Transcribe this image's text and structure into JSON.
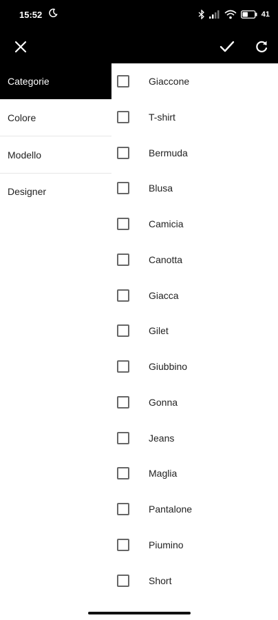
{
  "status_bar": {
    "time": "15:52",
    "battery": "41"
  },
  "toolbar": {
    "close_icon": "close-icon",
    "confirm_icon": "check-icon",
    "reset_icon": "refresh-icon"
  },
  "sidebar": {
    "items": [
      {
        "label": "Categorie",
        "active": true
      },
      {
        "label": "Colore",
        "active": false
      },
      {
        "label": "Modello",
        "active": false
      },
      {
        "label": "Designer",
        "active": false
      }
    ]
  },
  "options": [
    {
      "label": "Giaccone",
      "checked": false
    },
    {
      "label": "T-shirt",
      "checked": false
    },
    {
      "label": "Bermuda",
      "checked": false
    },
    {
      "label": "Blusa",
      "checked": false
    },
    {
      "label": "Camicia",
      "checked": false
    },
    {
      "label": "Canotta",
      "checked": false
    },
    {
      "label": "Giacca",
      "checked": false
    },
    {
      "label": "Gilet",
      "checked": false
    },
    {
      "label": "Giubbino",
      "checked": false
    },
    {
      "label": "Gonna",
      "checked": false
    },
    {
      "label": "Jeans",
      "checked": false
    },
    {
      "label": "Maglia",
      "checked": false
    },
    {
      "label": "Pantalone",
      "checked": false
    },
    {
      "label": "Piumino",
      "checked": false
    },
    {
      "label": "Short",
      "checked": false
    }
  ],
  "colors": {
    "bar_background": "#000000",
    "accent_text": "#ffffff",
    "checkbox_border": "#666666"
  }
}
